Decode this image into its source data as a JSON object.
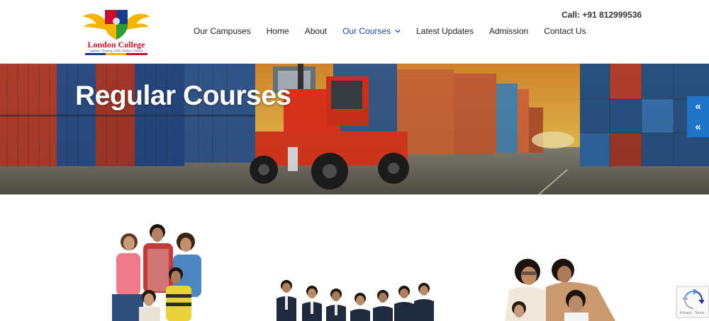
{
  "logo": {
    "name": "London College",
    "tagline": "Logistics | Shipping | SCM | Aviation | Fashion"
  },
  "header": {
    "call": "Call: +91 812999536"
  },
  "nav": {
    "items": [
      {
        "label": "Our Campuses"
      },
      {
        "label": "Home"
      },
      {
        "label": "About"
      },
      {
        "label": "Our Courses"
      },
      {
        "label": "Latest Updates"
      },
      {
        "label": "Admission"
      },
      {
        "label": "Contact Us"
      }
    ]
  },
  "hero": {
    "title": "Regular Courses"
  },
  "side_buttons": {
    "first": "«",
    "second": "«"
  },
  "recaptcha": {
    "text": "Privacy - Terms"
  },
  "colors": {
    "accent": "#1f4c9a",
    "side_button": "#1e74c7",
    "forklift": "#e8361e"
  }
}
